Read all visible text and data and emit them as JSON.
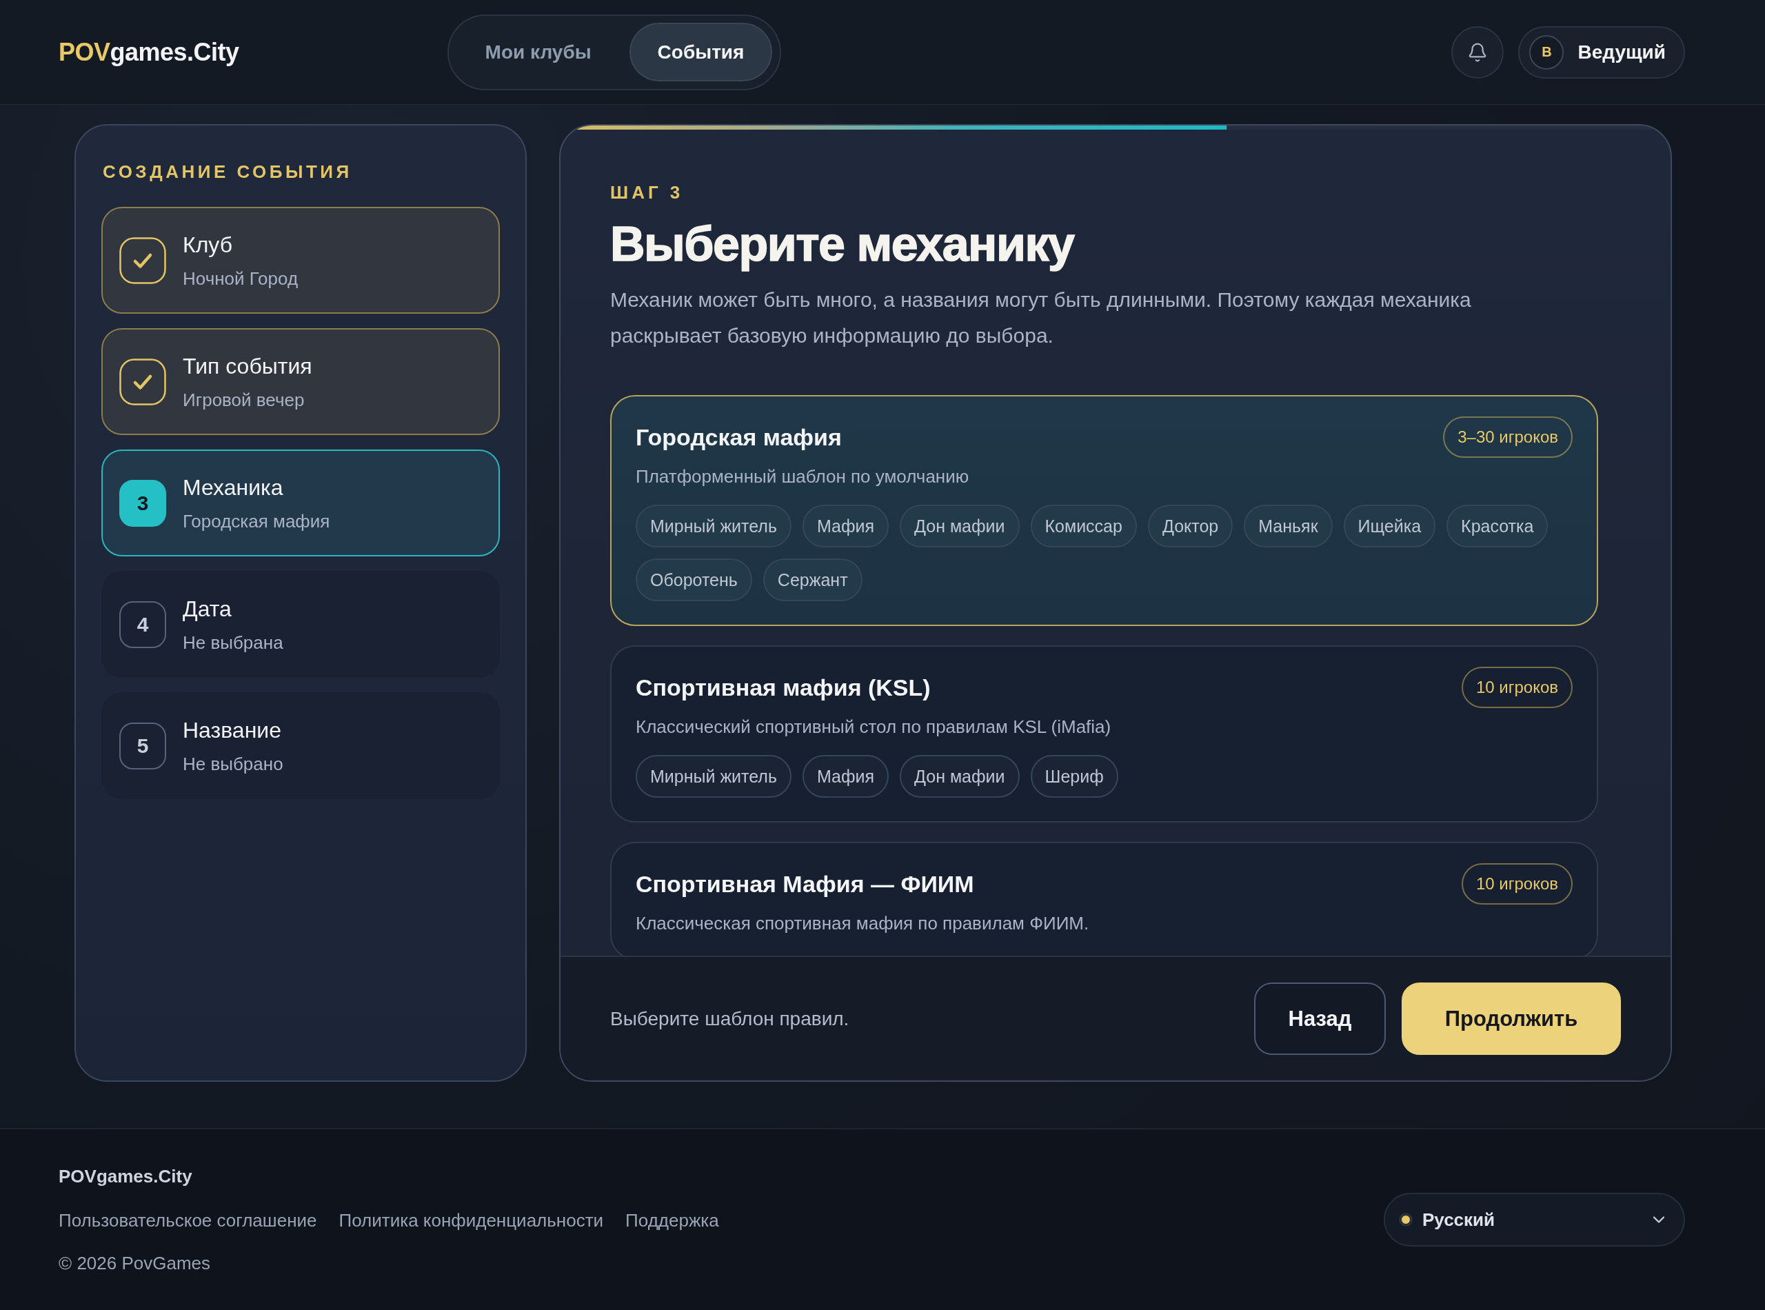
{
  "header": {
    "logo": {
      "accent": "POV",
      "rest": "games.City"
    },
    "nav": [
      {
        "label": "Мои клубы",
        "selected": false
      },
      {
        "label": "События",
        "selected": true
      }
    ],
    "user": {
      "initial": "В",
      "name": "Ведущий"
    }
  },
  "sidebar": {
    "title": "СОЗДАНИЕ СОБЫТИЯ",
    "steps": [
      {
        "done": true,
        "selected": false,
        "title": "Клуб",
        "value": "Ночной Город"
      },
      {
        "done": true,
        "selected": false,
        "title": "Тип события",
        "value": "Игровой вечер"
      },
      {
        "done": false,
        "selected": true,
        "number": "3",
        "title": "Механика",
        "value": "Городская мафия"
      },
      {
        "done": false,
        "selected": false,
        "number": "4",
        "title": "Дата",
        "value": "Не выбрана"
      },
      {
        "done": false,
        "selected": false,
        "number": "5",
        "title": "Название",
        "value": "Не выбрано"
      }
    ]
  },
  "main": {
    "progress": {
      "level": 0.6
    },
    "eyebrow": "ШАГ 3",
    "title": "Выберите механику",
    "description": "Механик может быть много, а названия могут быть длинными. Поэтому каждая механика раскрывает базовую информацию до выбора.",
    "mechanics": [
      {
        "title": "Городская мафия",
        "players": "3–30 игроков",
        "subtitle": "Платформенный шаблон по умолчанию",
        "selected": true,
        "roles": [
          "Мирный житель",
          "Мафия",
          "Дон мафии",
          "Комиссар",
          "Доктор",
          "Маньяк",
          "Ищейка",
          "Красотка",
          "Оборотень",
          "Сержант"
        ]
      },
      {
        "title": "Спортивная мафия (KSL)",
        "players": "10 игроков",
        "subtitle": "Классический спортивный стол по правилам KSL (iMafia)",
        "selected": false,
        "roles": [
          "Мирный житель",
          "Мафия",
          "Дон мафии",
          "Шериф"
        ]
      },
      {
        "title": "Спортивная Мафия — ФИИМ",
        "players": "10 игроков",
        "subtitle": "Классическая спортивная мафия по правилам ФИИМ.",
        "selected": false
      }
    ],
    "hint": "Выберите шаблон правил.",
    "buttons": [
      {
        "label": "Назад",
        "kind": "secondary"
      },
      {
        "label": "Продолжить",
        "kind": "primary"
      }
    ]
  },
  "footer": {
    "brand": "POVgames.City",
    "links": [
      "Пользовательское соглашение",
      "Политика конфиденциальности",
      "Поддержка"
    ],
    "copyright": "© 2026 PovGames",
    "language": {
      "label": "Русский"
    }
  }
}
